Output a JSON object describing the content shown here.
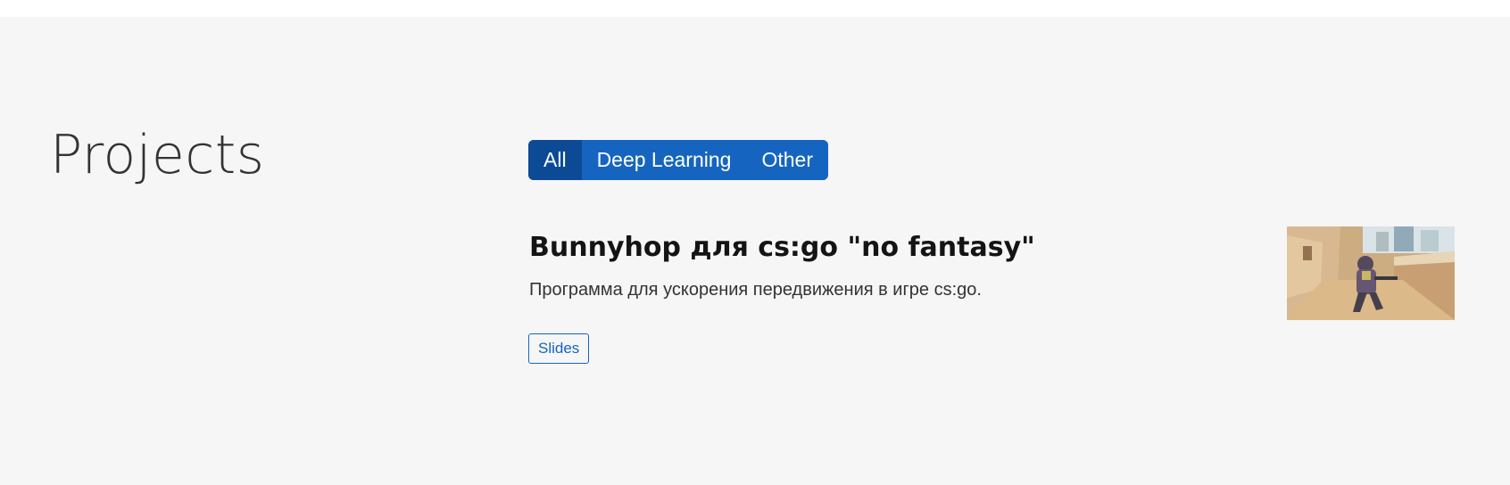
{
  "section": {
    "title": "Projects"
  },
  "filters": {
    "items": [
      {
        "label": "All",
        "active": true
      },
      {
        "label": "Deep Learning",
        "active": false
      },
      {
        "label": "Other",
        "active": false
      }
    ]
  },
  "project": {
    "title": "Bunnyhop для cs:go \"no fantasy\"",
    "summary": "Программа для ускорения передвижения в игре cs:go.",
    "slides_label": "Slides",
    "thumbnail_alt": "project thumbnail"
  },
  "colors": {
    "accent": "#1565c0",
    "accent_active": "#0d4a96",
    "section_bg": "#f6f6f6",
    "title_text": "#333333"
  }
}
